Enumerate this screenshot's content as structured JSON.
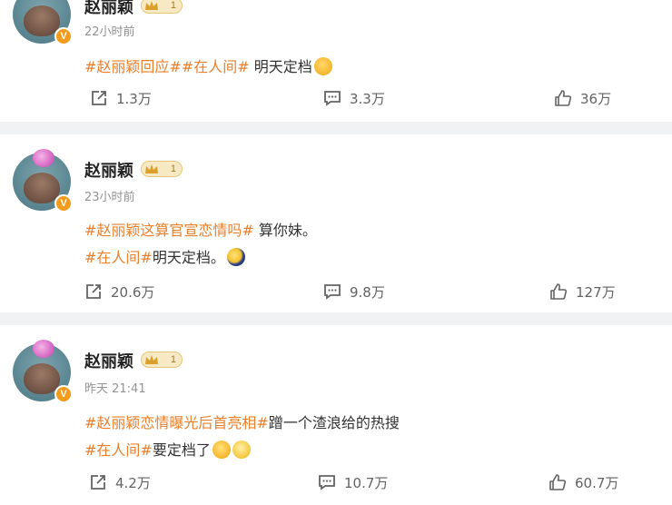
{
  "posts": [
    {
      "username": "赵丽颖",
      "level": "1",
      "verified": "V",
      "time": "22小时前",
      "lines": [
        [
          {
            "t": "tag",
            "text": "#赵丽颖回应#"
          },
          {
            "t": "tag",
            "text": "#在人间#"
          },
          {
            "t": "text",
            "text": " 明天定档"
          },
          {
            "t": "emoji",
            "name": "shy-emoji"
          }
        ]
      ],
      "shares": "1.3万",
      "comments": "3.3万",
      "likes": "36万"
    },
    {
      "username": "赵丽颖",
      "level": "1",
      "verified": "V",
      "time": "23小时前",
      "lines": [
        [
          {
            "t": "tag",
            "text": "#赵丽颖这算官宣恋情吗#"
          },
          {
            "t": "text",
            "text": " 算你妹。"
          }
        ],
        [
          {
            "t": "tag",
            "text": "#在人间#"
          },
          {
            "t": "text",
            "text": "明天定档。"
          },
          {
            "t": "emoji",
            "name": "moon-emoji"
          }
        ]
      ],
      "shares": "20.6万",
      "comments": "9.8万",
      "likes": "127万"
    },
    {
      "username": "赵丽颖",
      "level": "1",
      "verified": "V",
      "time": "昨天 21:41",
      "lines": [
        [
          {
            "t": "tag",
            "text": "#赵丽颖恋情曝光后首亮相#"
          },
          {
            "t": "text",
            "text": "蹭一个渣浪给的热搜"
          }
        ],
        [
          {
            "t": "tag",
            "text": "#在人间#"
          },
          {
            "t": "text",
            "text": "要定档了"
          },
          {
            "t": "emoji",
            "name": "laugh-emoji"
          },
          {
            "t": "emoji",
            "name": "shocked-emoji"
          }
        ]
      ],
      "shares": "4.2万",
      "comments": "10.7万",
      "likes": "60.7万"
    }
  ],
  "colors": {
    "topic": "#e8802e",
    "meta": "#939393",
    "action": "#636363",
    "divider": "#f1f2f4",
    "crown_bg": "#f7e9c3"
  },
  "icons": {
    "share": "share-icon",
    "comment": "comment-icon",
    "like": "like-icon",
    "crown": "crown-icon"
  }
}
